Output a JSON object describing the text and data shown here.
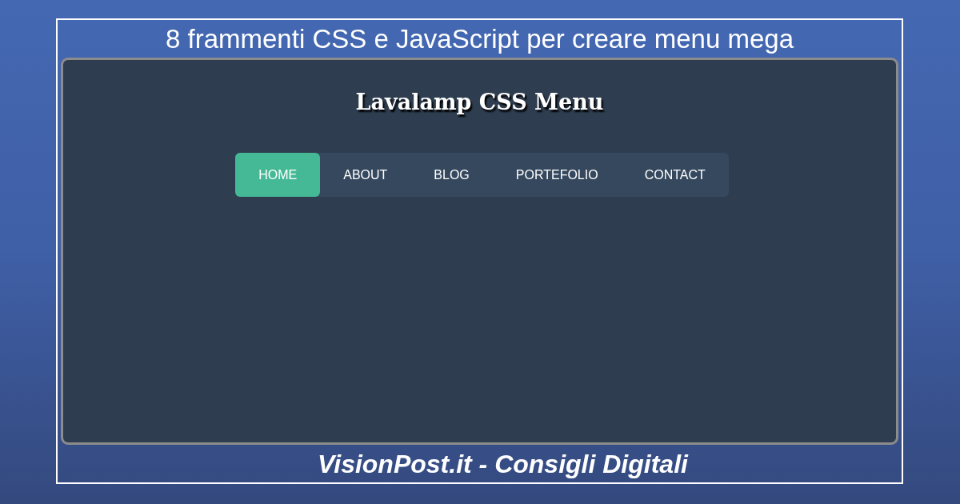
{
  "banner": {
    "title": "8 frammenti CSS e JavaScript per creare menu mega"
  },
  "screenshot": {
    "heading": "Lavalamp CSS Menu",
    "menu": [
      {
        "label": "HOME",
        "selected": true
      },
      {
        "label": "ABOUT",
        "selected": false
      },
      {
        "label": "BLOG",
        "selected": false
      },
      {
        "label": "PORTEFOLIO",
        "selected": false
      },
      {
        "label": "CONTACT",
        "selected": false
      }
    ]
  },
  "footer": {
    "caption": "VisionPost.it - Consigli Digitali"
  }
}
